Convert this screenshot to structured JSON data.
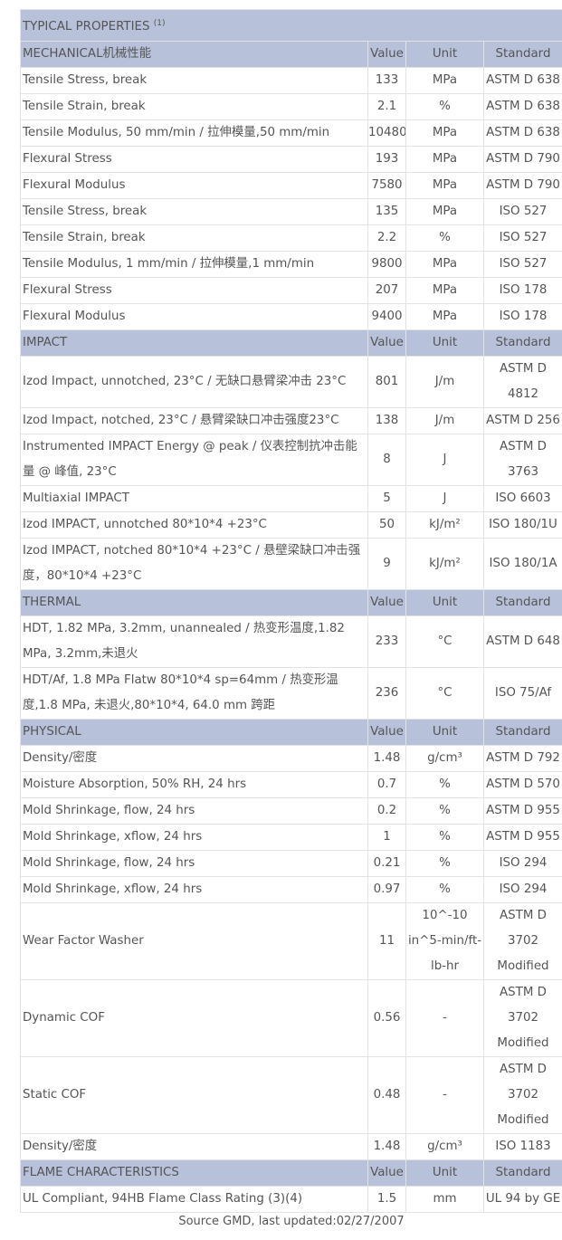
{
  "title": {
    "text": "TYPICAL PROPERTIES",
    "footnote": "(1)"
  },
  "sections": [
    {
      "name": "MECHANICAL机械性能",
      "value": "Value",
      "unit": "Unit",
      "standard": "Standard",
      "rows": [
        {
          "property": "Tensile Stress, break",
          "value": "133",
          "unit": "MPa",
          "standard": "ASTM D 638"
        },
        {
          "property": "Tensile Strain, break",
          "value": "2.1",
          "unit": "%",
          "standard": "ASTM D 638"
        },
        {
          "property": "Tensile Modulus, 50 mm/min / 拉伸模量,50 mm/min",
          "value": "10480",
          "unit": "MPa",
          "standard": "ASTM D 638"
        },
        {
          "property": "Flexural Stress",
          "value": "193",
          "unit": "MPa",
          "standard": "ASTM D 790"
        },
        {
          "property": "Flexural Modulus",
          "value": "7580",
          "unit": "MPa",
          "standard": "ASTM D 790"
        },
        {
          "property": "Tensile Stress, break",
          "value": "135",
          "unit": "MPa",
          "standard": "ISO 527"
        },
        {
          "property": "Tensile Strain, break",
          "value": "2.2",
          "unit": "%",
          "standard": "ISO 527"
        },
        {
          "property": "Tensile Modulus, 1 mm/min / 拉伸模量,1 mm/min",
          "value": "9800",
          "unit": "MPa",
          "standard": "ISO 527"
        },
        {
          "property": "Flexural Stress",
          "value": "207",
          "unit": "MPa",
          "standard": "ISO 178"
        },
        {
          "property": "Flexural Modulus",
          "value": "9400",
          "unit": "MPa",
          "standard": "ISO 178"
        }
      ]
    },
    {
      "name": "IMPACT",
      "value": "Value",
      "unit": "Unit",
      "standard": "Standard",
      "rows": [
        {
          "property": "Izod Impact, unnotched, 23°C / 无缺口悬臂梁冲击 23°C",
          "value": "801",
          "unit": "J/m",
          "standard": "ASTM D 4812",
          "h": 56
        },
        {
          "property": "Izod Impact, notched, 23°C / 悬臂梁缺口冲击强度23°C",
          "value": "138",
          "unit": "J/m",
          "standard": "ASTM D 256"
        },
        {
          "property": "Instrumented IMPACT Energy @ peak / 仪表控制抗冲击能量 @ 峰值, 23°C",
          "value": "8",
          "unit": "J",
          "standard": "ASTM D 3763",
          "h": 56
        },
        {
          "property": "Multiaxial IMPACT",
          "value": "5",
          "unit": "J",
          "standard": "ISO 6603"
        },
        {
          "property": "Izod IMPACT, unnotched 80*10*4 +23°C",
          "value": "50",
          "unit": "kJ/m²",
          "standard": "ISO 180/1U"
        },
        {
          "property": "Izod IMPACT, notched 80*10*4 +23°C / 悬壁梁缺口冲击强度，80*10*4 +23°C",
          "value": "9",
          "unit": "kJ/m²",
          "standard": "ISO 180/1A",
          "h": 56
        }
      ]
    },
    {
      "name": "THERMAL",
      "value": "Value",
      "unit": "Unit",
      "standard": "Standard",
      "rows": [
        {
          "property": "HDT, 1.82 MPa, 3.2mm, unannealed / 热变形温度,1.82 MPa, 3.2mm,未退火",
          "value": "233",
          "unit": "°C",
          "standard": "ASTM D 648",
          "h": 56
        },
        {
          "property": "HDT/Af, 1.8 MPa Flatw 80*10*4 sp=64mm / 热变形温度,1.8 MPa, 未退火,80*10*4,   64.0 mm 跨距",
          "value": "236",
          "unit": "°C",
          "standard": "ISO 75/Af",
          "h": 56
        }
      ]
    },
    {
      "name": "PHYSICAL",
      "value": "Value",
      "unit": "Unit",
      "standard": "Standard",
      "rows": [
        {
          "property": "Density/密度",
          "value": "1.48",
          "unit": "g/cm³",
          "standard": "ASTM D 792"
        },
        {
          "property": "Moisture Absorption, 50% RH, 24 hrs",
          "value": "0.7",
          "unit": "%",
          "standard": "ASTM D 570"
        },
        {
          "property": "Mold Shrinkage, flow, 24 hrs",
          "value": "0.2",
          "unit": "%",
          "standard": "ASTM D 955"
        },
        {
          "property": "Mold Shrinkage, xflow, 24 hrs",
          "value": "1",
          "unit": "%",
          "standard": "ASTM D 955"
        },
        {
          "property": "Mold Shrinkage, flow, 24 hrs",
          "value": "0.21",
          "unit": "%",
          "standard": "ISO 294"
        },
        {
          "property": "Mold Shrinkage, xflow, 24 hrs",
          "value": "0.97",
          "unit": "%",
          "standard": "ISO 294"
        },
        {
          "property": "Wear Factor Washer",
          "value": "11",
          "unit": "10^-10 in^5-min/ft-lb-hr",
          "standard": "ASTM D 3702 Modified",
          "h": 84
        },
        {
          "property": "Dynamic COF",
          "value": "0.56",
          "unit": "-",
          "standard": "ASTM D 3702 Modified",
          "h": 84
        },
        {
          "property": "Static COF",
          "value": "0.48",
          "unit": "-",
          "standard": "ASTM D 3702 Modified",
          "h": 84
        },
        {
          "property": "Density/密度",
          "value": "1.48",
          "unit": "g/cm³",
          "standard": "ISO 1183"
        }
      ]
    },
    {
      "name": "FLAME CHARACTERISTICS",
      "value": "Value",
      "unit": "Unit",
      "standard": "Standard",
      "rows": [
        {
          "property": "UL Compliant, 94HB Flame Class Rating (3)(4)",
          "value": "1.5",
          "unit": "mm",
          "standard": "UL 94 by GE"
        }
      ]
    }
  ],
  "footer": "Source GMD, last updated:02/27/2007"
}
